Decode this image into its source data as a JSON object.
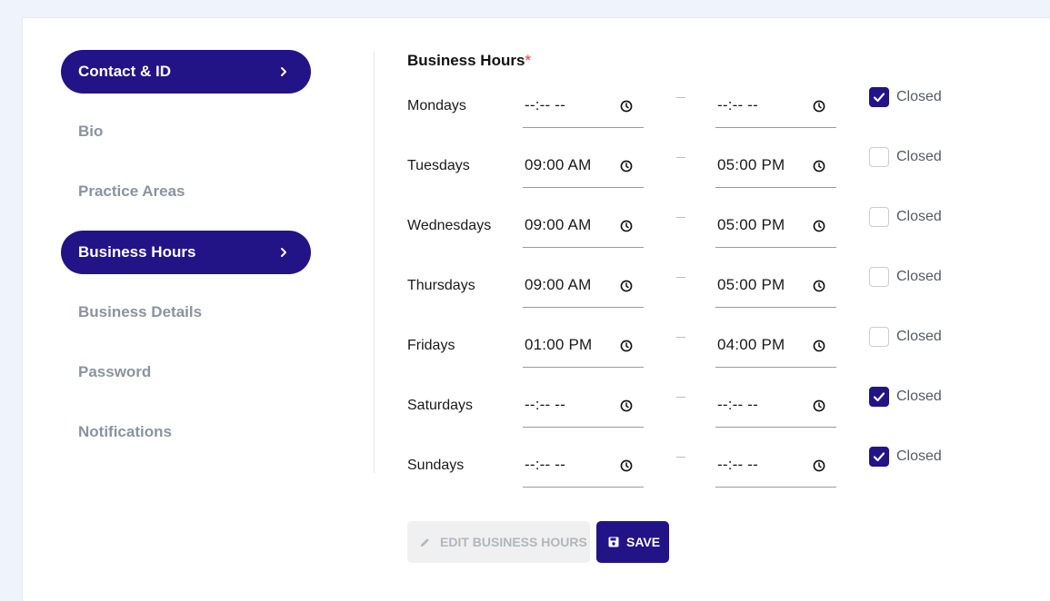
{
  "sidebar": {
    "items": [
      {
        "label": "Contact & ID",
        "active": true
      },
      {
        "label": "Bio",
        "active": false
      },
      {
        "label": "Practice Areas",
        "active": false
      },
      {
        "label": "Business Hours",
        "active": true
      },
      {
        "label": "Business Details",
        "active": false
      },
      {
        "label": "Password",
        "active": false
      },
      {
        "label": "Notifications",
        "active": false
      }
    ]
  },
  "main": {
    "title": "Business Hours",
    "required_mark": "*",
    "closed_label": "Closed",
    "separator": "–",
    "days": [
      {
        "label": "Mondays",
        "open": "--:-- --",
        "close": "--:-- --",
        "closed": true
      },
      {
        "label": "Tuesdays",
        "open": "09:00 AM",
        "close": "05:00 PM",
        "closed": false
      },
      {
        "label": "Wednesdays",
        "open": "09:00 AM",
        "close": "05:00 PM",
        "closed": false
      },
      {
        "label": "Thursdays",
        "open": "09:00 AM",
        "close": "05:00 PM",
        "closed": false
      },
      {
        "label": "Fridays",
        "open": "01:00 PM",
        "close": "04:00 PM",
        "closed": false
      },
      {
        "label": "Saturdays",
        "open": "--:-- --",
        "close": "--:-- --",
        "closed": true
      },
      {
        "label": "Sundays",
        "open": "--:-- --",
        "close": "--:-- --",
        "closed": true
      }
    ],
    "buttons": {
      "edit_label": "EDIT BUSINESS HOURS",
      "save_label": "SAVE"
    }
  },
  "colors": {
    "accent": "#221487",
    "required": "#e53935",
    "muted_nav": "#8a939f"
  },
  "icons": {
    "nav_chevron": "chevron-right-icon",
    "time_field": "clock-icon",
    "checkbox": "checkmark-icon",
    "edit": "pencil-icon",
    "save": "floppy-disk-icon"
  }
}
